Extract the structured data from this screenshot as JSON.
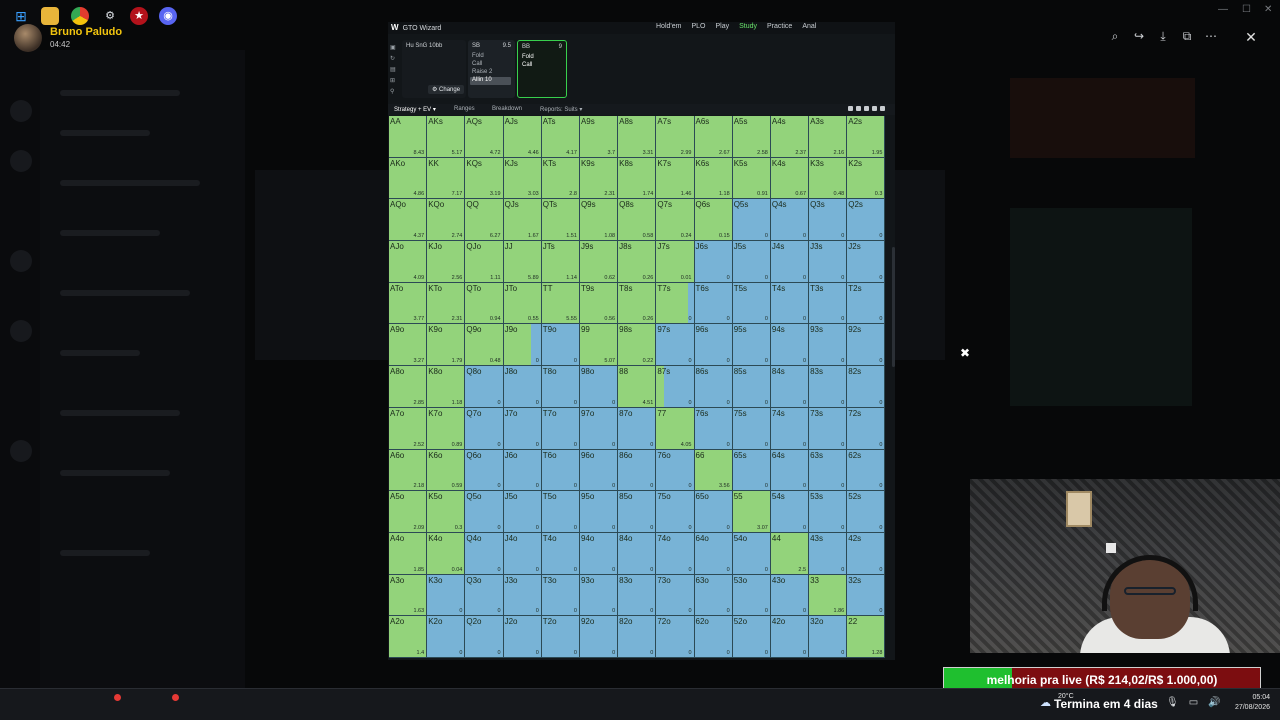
{
  "user": {
    "name": "Bruno Paludo",
    "time": "04:42"
  },
  "viewer": {
    "icons": [
      "zoom-icon",
      "share-icon",
      "download-icon",
      "open-external-icon",
      "more-icon"
    ],
    "close": "✕"
  },
  "gto": {
    "brand": "GTO Wizard",
    "nav": {
      "game": "Hold'em",
      "variant": "PLO",
      "play": "Play",
      "study": "Study",
      "practice": "Practice",
      "analyze": "Anal"
    },
    "config": {
      "label": "Hu SnG 10bb"
    },
    "sb": {
      "pos": "SB",
      "stack": "9.5",
      "actions": [
        "Fold",
        "Call",
        "Raise 2",
        "Allin 10"
      ]
    },
    "bb": {
      "pos": "BB",
      "stack": "9",
      "actions": [
        "Fold",
        "Call"
      ]
    },
    "change": "⚙ Change",
    "tabs": {
      "strategy": "Strategy + EV ▾",
      "ranges": "Ranges",
      "breakdown": "Breakdown",
      "reports": "Reports: Suits ▾"
    },
    "colors": {
      "call": "#93d37b",
      "fold": "#78b3d6"
    },
    "grid": [
      {
        "h": "AA",
        "c": 1,
        "ev": "8.43"
      },
      {
        "h": "AKs",
        "c": 1,
        "ev": "5.17"
      },
      {
        "h": "AQs",
        "c": 1,
        "ev": "4.72"
      },
      {
        "h": "AJs",
        "c": 1,
        "ev": "4.46"
      },
      {
        "h": "ATs",
        "c": 1,
        "ev": "4.17"
      },
      {
        "h": "A9s",
        "c": 1,
        "ev": "3.7"
      },
      {
        "h": "A8s",
        "c": 1,
        "ev": "3.31"
      },
      {
        "h": "A7s",
        "c": 1,
        "ev": "2.99"
      },
      {
        "h": "A6s",
        "c": 1,
        "ev": "2.67"
      },
      {
        "h": "A5s",
        "c": 1,
        "ev": "2.58"
      },
      {
        "h": "A4s",
        "c": 1,
        "ev": "2.37"
      },
      {
        "h": "A3s",
        "c": 1,
        "ev": "2.16"
      },
      {
        "h": "A2s",
        "c": 1,
        "ev": "1.95"
      },
      {
        "h": "AKo",
        "c": 1,
        "ev": "4.86"
      },
      {
        "h": "KK",
        "c": 1,
        "ev": "7.17"
      },
      {
        "h": "KQs",
        "c": 1,
        "ev": "3.19"
      },
      {
        "h": "KJs",
        "c": 1,
        "ev": "3.03"
      },
      {
        "h": "KTs",
        "c": 1,
        "ev": "2.8"
      },
      {
        "h": "K9s",
        "c": 1,
        "ev": "2.31"
      },
      {
        "h": "K8s",
        "c": 1,
        "ev": "1.74"
      },
      {
        "h": "K7s",
        "c": 1,
        "ev": "1.46"
      },
      {
        "h": "K6s",
        "c": 1,
        "ev": "1.18"
      },
      {
        "h": "K5s",
        "c": 1,
        "ev": "0.91"
      },
      {
        "h": "K4s",
        "c": 1,
        "ev": "0.67"
      },
      {
        "h": "K3s",
        "c": 1,
        "ev": "0.48"
      },
      {
        "h": "K2s",
        "c": 1,
        "ev": "0.3"
      },
      {
        "h": "AQo",
        "c": 1,
        "ev": "4.37"
      },
      {
        "h": "KQo",
        "c": 1,
        "ev": "2.74"
      },
      {
        "h": "QQ",
        "c": 1,
        "ev": "6.27"
      },
      {
        "h": "QJs",
        "c": 1,
        "ev": "1.67"
      },
      {
        "h": "QTs",
        "c": 1,
        "ev": "1.51"
      },
      {
        "h": "Q9s",
        "c": 1,
        "ev": "1.08"
      },
      {
        "h": "Q8s",
        "c": 1,
        "ev": "0.58"
      },
      {
        "h": "Q7s",
        "c": 1,
        "ev": "0.24"
      },
      {
        "h": "Q6s",
        "c": 1,
        "ev": "0.15"
      },
      {
        "h": "Q5s",
        "c": 0,
        "ev": "0"
      },
      {
        "h": "Q4s",
        "c": 0,
        "ev": "0"
      },
      {
        "h": "Q3s",
        "c": 0,
        "ev": "0"
      },
      {
        "h": "Q2s",
        "c": 0,
        "ev": "0"
      },
      {
        "h": "AJo",
        "c": 1,
        "ev": "4.09"
      },
      {
        "h": "KJo",
        "c": 1,
        "ev": "2.56"
      },
      {
        "h": "QJo",
        "c": 1,
        "ev": "1.11"
      },
      {
        "h": "JJ",
        "c": 1,
        "ev": "5.89"
      },
      {
        "h": "JTs",
        "c": 1,
        "ev": "1.14"
      },
      {
        "h": "J9s",
        "c": 1,
        "ev": "0.62"
      },
      {
        "h": "J8s",
        "c": 1,
        "ev": "0.26"
      },
      {
        "h": "J7s",
        "c": 1,
        "ev": "0.01"
      },
      {
        "h": "J6s",
        "c": 0,
        "ev": "0"
      },
      {
        "h": "J5s",
        "c": 0,
        "ev": "0"
      },
      {
        "h": "J4s",
        "c": 0,
        "ev": "0"
      },
      {
        "h": "J3s",
        "c": 0,
        "ev": "0"
      },
      {
        "h": "J2s",
        "c": 0,
        "ev": "0"
      },
      {
        "h": "ATo",
        "c": 1,
        "ev": "3.77"
      },
      {
        "h": "KTo",
        "c": 1,
        "ev": "2.31"
      },
      {
        "h": "QTo",
        "c": 1,
        "ev": "0.94"
      },
      {
        "h": "JTo",
        "c": 1,
        "ev": "0.55"
      },
      {
        "h": "TT",
        "c": 1,
        "ev": "5.55"
      },
      {
        "h": "T9s",
        "c": 1,
        "ev": "0.56"
      },
      {
        "h": "T8s",
        "c": 1,
        "ev": "0.26"
      },
      {
        "h": "T7s",
        "c": 0.85,
        "ev": "0"
      },
      {
        "h": "T6s",
        "c": 0,
        "ev": "0"
      },
      {
        "h": "T5s",
        "c": 0,
        "ev": "0"
      },
      {
        "h": "T4s",
        "c": 0,
        "ev": "0"
      },
      {
        "h": "T3s",
        "c": 0,
        "ev": "0"
      },
      {
        "h": "T2s",
        "c": 0,
        "ev": "0"
      },
      {
        "h": "A9o",
        "c": 1,
        "ev": "3.27"
      },
      {
        "h": "K9o",
        "c": 1,
        "ev": "1.79"
      },
      {
        "h": "Q9o",
        "c": 1,
        "ev": "0.48"
      },
      {
        "h": "J9o",
        "c": 0.75,
        "ev": "0"
      },
      {
        "h": "T9o",
        "c": 0,
        "ev": "0"
      },
      {
        "h": "99",
        "c": 1,
        "ev": "5.07"
      },
      {
        "h": "98s",
        "c": 1,
        "ev": "0.22"
      },
      {
        "h": "97s",
        "c": 0,
        "ev": "0"
      },
      {
        "h": "96s",
        "c": 0,
        "ev": "0"
      },
      {
        "h": "95s",
        "c": 0,
        "ev": "0"
      },
      {
        "h": "94s",
        "c": 0,
        "ev": "0"
      },
      {
        "h": "93s",
        "c": 0,
        "ev": "0"
      },
      {
        "h": "92s",
        "c": 0,
        "ev": "0"
      },
      {
        "h": "A8o",
        "c": 1,
        "ev": "2.85"
      },
      {
        "h": "K8o",
        "c": 1,
        "ev": "1.18"
      },
      {
        "h": "Q8o",
        "c": 0,
        "ev": "0"
      },
      {
        "h": "J8o",
        "c": 0,
        "ev": "0"
      },
      {
        "h": "T8o",
        "c": 0,
        "ev": "0"
      },
      {
        "h": "98o",
        "c": 0,
        "ev": "0"
      },
      {
        "h": "88",
        "c": 1,
        "ev": "4.51"
      },
      {
        "h": "87s",
        "c": 0.2,
        "ev": "0"
      },
      {
        "h": "86s",
        "c": 0,
        "ev": "0"
      },
      {
        "h": "85s",
        "c": 0,
        "ev": "0"
      },
      {
        "h": "84s",
        "c": 0,
        "ev": "0"
      },
      {
        "h": "83s",
        "c": 0,
        "ev": "0"
      },
      {
        "h": "82s",
        "c": 0,
        "ev": "0"
      },
      {
        "h": "A7o",
        "c": 1,
        "ev": "2.52"
      },
      {
        "h": "K7o",
        "c": 1,
        "ev": "0.89"
      },
      {
        "h": "Q7o",
        "c": 0,
        "ev": "0"
      },
      {
        "h": "J7o",
        "c": 0,
        "ev": "0"
      },
      {
        "h": "T7o",
        "c": 0,
        "ev": "0"
      },
      {
        "h": "97o",
        "c": 0,
        "ev": "0"
      },
      {
        "h": "87o",
        "c": 0,
        "ev": "0"
      },
      {
        "h": "77",
        "c": 1,
        "ev": "4.05"
      },
      {
        "h": "76s",
        "c": 0,
        "ev": "0"
      },
      {
        "h": "75s",
        "c": 0,
        "ev": "0"
      },
      {
        "h": "74s",
        "c": 0,
        "ev": "0"
      },
      {
        "h": "73s",
        "c": 0,
        "ev": "0"
      },
      {
        "h": "72s",
        "c": 0,
        "ev": "0"
      },
      {
        "h": "A6o",
        "c": 1,
        "ev": "2.18"
      },
      {
        "h": "K6o",
        "c": 1,
        "ev": "0.59"
      },
      {
        "h": "Q6o",
        "c": 0,
        "ev": "0"
      },
      {
        "h": "J6o",
        "c": 0,
        "ev": "0"
      },
      {
        "h": "T6o",
        "c": 0,
        "ev": "0"
      },
      {
        "h": "96o",
        "c": 0,
        "ev": "0"
      },
      {
        "h": "86o",
        "c": 0,
        "ev": "0"
      },
      {
        "h": "76o",
        "c": 0,
        "ev": "0"
      },
      {
        "h": "66",
        "c": 1,
        "ev": "3.56"
      },
      {
        "h": "65s",
        "c": 0,
        "ev": "0"
      },
      {
        "h": "64s",
        "c": 0,
        "ev": "0"
      },
      {
        "h": "63s",
        "c": 0,
        "ev": "0"
      },
      {
        "h": "62s",
        "c": 0,
        "ev": "0"
      },
      {
        "h": "A5o",
        "c": 1,
        "ev": "2.09"
      },
      {
        "h": "K5o",
        "c": 1,
        "ev": "0.3"
      },
      {
        "h": "Q5o",
        "c": 0,
        "ev": "0"
      },
      {
        "h": "J5o",
        "c": 0,
        "ev": "0"
      },
      {
        "h": "T5o",
        "c": 0,
        "ev": "0"
      },
      {
        "h": "95o",
        "c": 0,
        "ev": "0"
      },
      {
        "h": "85o",
        "c": 0,
        "ev": "0"
      },
      {
        "h": "75o",
        "c": 0,
        "ev": "0"
      },
      {
        "h": "65o",
        "c": 0,
        "ev": "0"
      },
      {
        "h": "55",
        "c": 1,
        "ev": "3.07"
      },
      {
        "h": "54s",
        "c": 0,
        "ev": "0"
      },
      {
        "h": "53s",
        "c": 0,
        "ev": "0"
      },
      {
        "h": "52s",
        "c": 0,
        "ev": "0"
      },
      {
        "h": "A4o",
        "c": 1,
        "ev": "1.85"
      },
      {
        "h": "K4o",
        "c": 1,
        "ev": "0.04"
      },
      {
        "h": "Q4o",
        "c": 0,
        "ev": "0"
      },
      {
        "h": "J4o",
        "c": 0,
        "ev": "0"
      },
      {
        "h": "T4o",
        "c": 0,
        "ev": "0"
      },
      {
        "h": "94o",
        "c": 0,
        "ev": "0"
      },
      {
        "h": "84o",
        "c": 0,
        "ev": "0"
      },
      {
        "h": "74o",
        "c": 0,
        "ev": "0"
      },
      {
        "h": "64o",
        "c": 0,
        "ev": "0"
      },
      {
        "h": "54o",
        "c": 0,
        "ev": "0"
      },
      {
        "h": "44",
        "c": 1,
        "ev": "2.5"
      },
      {
        "h": "43s",
        "c": 0,
        "ev": "0"
      },
      {
        "h": "42s",
        "c": 0,
        "ev": "0"
      },
      {
        "h": "A3o",
        "c": 1,
        "ev": "1.63"
      },
      {
        "h": "K3o",
        "c": 0,
        "ev": "0"
      },
      {
        "h": "Q3o",
        "c": 0,
        "ev": "0"
      },
      {
        "h": "J3o",
        "c": 0,
        "ev": "0"
      },
      {
        "h": "T3o",
        "c": 0,
        "ev": "0"
      },
      {
        "h": "93o",
        "c": 0,
        "ev": "0"
      },
      {
        "h": "83o",
        "c": 0,
        "ev": "0"
      },
      {
        "h": "73o",
        "c": 0,
        "ev": "0"
      },
      {
        "h": "63o",
        "c": 0,
        "ev": "0"
      },
      {
        "h": "53o",
        "c": 0,
        "ev": "0"
      },
      {
        "h": "43o",
        "c": 0,
        "ev": "0"
      },
      {
        "h": "33",
        "c": 1,
        "ev": "1.86"
      },
      {
        "h": "32s",
        "c": 0,
        "ev": "0"
      },
      {
        "h": "A2o",
        "c": 1,
        "ev": "1.4"
      },
      {
        "h": "K2o",
        "c": 0,
        "ev": "0"
      },
      {
        "h": "Q2o",
        "c": 0,
        "ev": "0"
      },
      {
        "h": "J2o",
        "c": 0,
        "ev": "0"
      },
      {
        "h": "T2o",
        "c": 0,
        "ev": "0"
      },
      {
        "h": "92o",
        "c": 0,
        "ev": "0"
      },
      {
        "h": "82o",
        "c": 0,
        "ev": "0"
      },
      {
        "h": "72o",
        "c": 0,
        "ev": "0"
      },
      {
        "h": "62o",
        "c": 0,
        "ev": "0"
      },
      {
        "h": "52o",
        "c": 0,
        "ev": "0"
      },
      {
        "h": "42o",
        "c": 0,
        "ev": "0"
      },
      {
        "h": "32o",
        "c": 0,
        "ev": "0"
      },
      {
        "h": "22",
        "c": 1,
        "ev": "1.28"
      }
    ]
  },
  "goal": {
    "text": "melhoria pra live (R$ 214,02/R$ 1.000,00)",
    "progress": 0.214
  },
  "taskbar": {
    "apps": [
      "windows-start-icon",
      "file-explorer-icon",
      "chrome-icon",
      "steam-icon",
      "pokerstars-icon",
      "discord-icon"
    ],
    "weather_temp": "20°C",
    "trial": "Termina em 4 dias",
    "time": "05:04",
    "date": "27/08/2026"
  }
}
